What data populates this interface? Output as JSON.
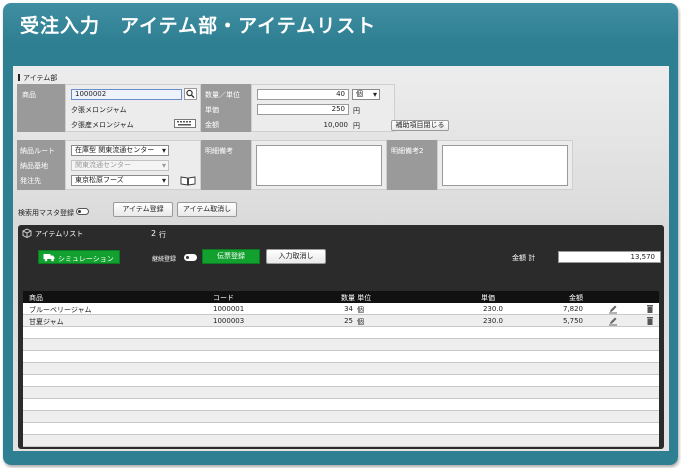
{
  "app": {
    "title": "受注入力　アイテム部・アイテムリスト"
  },
  "item_section": {
    "label": "アイテム部",
    "product_label": "商品",
    "product_code": "1000002",
    "product_name_1": "夕張メロンジャム",
    "product_name_2": "夕張産メロンジャム",
    "qty_unit_label": "数量／単位",
    "qty_value": "40",
    "unit_value": "個",
    "unit_price_label": "単価",
    "unit_price_value": "250",
    "unit_price_suffix": "円",
    "amount_label": "金額",
    "amount_value": "10,000",
    "amount_suffix": "円",
    "close_aux_button": "補助項目閉じる",
    "delivery_route_label": "納品ルート",
    "delivery_route_value": "在庫型 関東流通センター",
    "delivery_base_label": "納品基地",
    "delivery_base_value": "関東流通センター",
    "order_to_label": "発注先",
    "order_to_value": "東京松原フーズ",
    "note_label": "明細備考",
    "note2_label": "明細備考2",
    "search_master_label": "検索用マスタ登録",
    "item_register_button": "アイテム登録",
    "item_cancel_button": "アイテム取消し"
  },
  "item_list": {
    "label": "アイテムリスト",
    "row_count": "2",
    "row_count_suffix": "行",
    "simulation_button": "シミュレーション",
    "continue_register_label": "継続登録",
    "slip_register_button": "伝票登録",
    "input_cancel_button": "入力取消し",
    "total_label": "金額 計",
    "total_value": "13,570",
    "columns": {
      "product": "商品",
      "code": "コード",
      "qty_unit": "数量 単位",
      "unit_price": "単価",
      "amount": "金額"
    },
    "rows": [
      {
        "product": "ブルーベリージャム",
        "code": "1000001",
        "qty": "34",
        "unit": "個",
        "unit_price": "230.0",
        "amount": "7,820"
      },
      {
        "product": "甘夏ジャム",
        "code": "1000003",
        "qty": "25",
        "unit": "個",
        "unit_price": "230.0",
        "amount": "5,750"
      }
    ]
  },
  "colors": {
    "frame": "#2f7f93",
    "label_gray": "#9a9a9a",
    "green_button": "#12a12e",
    "list_bg": "#2b2b2b"
  },
  "icons": [
    "search-icon",
    "keyboard-icon",
    "book-icon",
    "cube-icon",
    "truck-icon",
    "edit-icon",
    "trash-icon"
  ]
}
